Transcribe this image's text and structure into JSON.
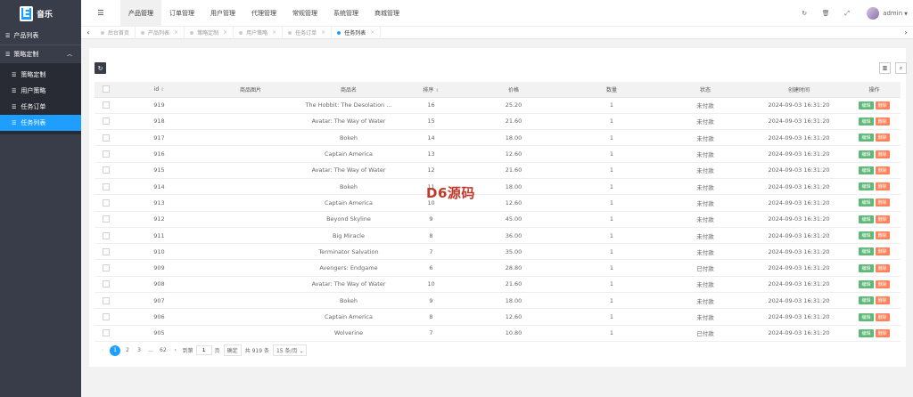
{
  "logo": {
    "letter": "E",
    "title": "音乐"
  },
  "sidebar": {
    "top_item": "产品列表",
    "parent_item": "策略定制",
    "sub_items": [
      {
        "label": "策略定制",
        "active": false
      },
      {
        "label": "用户策略",
        "active": false
      },
      {
        "label": "任务订单",
        "active": false
      },
      {
        "label": "任务列表",
        "active": true
      }
    ]
  },
  "header": {
    "nav": [
      "产品管理",
      "订单管理",
      "用户管理",
      "代理管理",
      "常规管理",
      "系统管理",
      "商城管理"
    ],
    "active_nav": 0,
    "username": "admin"
  },
  "tabs": [
    {
      "label": "后台首页",
      "closable": false,
      "active": false
    },
    {
      "label": "产品列表",
      "closable": true,
      "active": false
    },
    {
      "label": "策略定制",
      "closable": true,
      "active": false
    },
    {
      "label": "用户策略",
      "closable": true,
      "active": false
    },
    {
      "label": "任务订单",
      "closable": true,
      "active": false
    },
    {
      "label": "任务列表",
      "closable": true,
      "active": true
    }
  ],
  "table": {
    "columns": [
      "id",
      "商品图片",
      "商品名",
      "排序",
      "价格",
      "数量",
      "状态",
      "创建时间",
      "操作"
    ],
    "edit_label": "编辑",
    "delete_label": "删除",
    "rows": [
      {
        "id": "919",
        "name": "The Hobbit: The Desolation ...",
        "sort": "16",
        "price": "25.20",
        "qty": "1",
        "status": "未付款",
        "time": "2024-09-03 16:31:20"
      },
      {
        "id": "918",
        "name": "Avatar: The Way of Water",
        "sort": "15",
        "price": "21.60",
        "qty": "1",
        "status": "未付款",
        "time": "2024-09-03 16:31:20"
      },
      {
        "id": "917",
        "name": "Bokeh",
        "sort": "14",
        "price": "18.00",
        "qty": "1",
        "status": "未付款",
        "time": "2024-09-03 16:31:20"
      },
      {
        "id": "916",
        "name": "Captain America",
        "sort": "13",
        "price": "12.60",
        "qty": "1",
        "status": "未付款",
        "time": "2024-09-03 16:31:20"
      },
      {
        "id": "915",
        "name": "Avatar: The Way of Water",
        "sort": "12",
        "price": "21.60",
        "qty": "1",
        "status": "未付款",
        "time": "2024-09-03 16:31:20"
      },
      {
        "id": "914",
        "name": "Bokeh",
        "sort": "11",
        "price": "18.00",
        "qty": "1",
        "status": "未付款",
        "time": "2024-09-03 16:31:20"
      },
      {
        "id": "913",
        "name": "Captain America",
        "sort": "10",
        "price": "12.60",
        "qty": "1",
        "status": "未付款",
        "time": "2024-09-03 16:31:20"
      },
      {
        "id": "912",
        "name": "Beyond Skyline",
        "sort": "9",
        "price": "45.00",
        "qty": "1",
        "status": "未付款",
        "time": "2024-09-03 16:31:20"
      },
      {
        "id": "911",
        "name": "Big Miracle",
        "sort": "8",
        "price": "36.00",
        "qty": "1",
        "status": "未付款",
        "time": "2024-09-03 16:31:20"
      },
      {
        "id": "910",
        "name": "Terminator Salvation",
        "sort": "7",
        "price": "35.00",
        "qty": "1",
        "status": "未付款",
        "time": "2024-09-03 16:31:20"
      },
      {
        "id": "909",
        "name": "Avengers: Endgame",
        "sort": "6",
        "price": "28.80",
        "qty": "1",
        "status": "已付款",
        "time": "2024-09-03 16:31:20"
      },
      {
        "id": "908",
        "name": "Avatar: The Way of Water",
        "sort": "10",
        "price": "21.60",
        "qty": "1",
        "status": "未付款",
        "time": "2024-09-03 16:31:20"
      },
      {
        "id": "907",
        "name": "Bokeh",
        "sort": "9",
        "price": "18.00",
        "qty": "1",
        "status": "未付款",
        "time": "2024-09-03 16:31:20"
      },
      {
        "id": "906",
        "name": "Captain America",
        "sort": "8",
        "price": "12.60",
        "qty": "1",
        "status": "未付款",
        "time": "2024-09-03 16:31:20"
      },
      {
        "id": "905",
        "name": "Wolverine",
        "sort": "7",
        "price": "10.80",
        "qty": "1",
        "status": "已付款",
        "time": "2024-09-03 16:31:20"
      }
    ]
  },
  "pager": {
    "pages": [
      "1",
      "2",
      "3",
      "...",
      "62"
    ],
    "current": "1",
    "goto_label": "到第",
    "goto_value": "1",
    "page_suffix": "页",
    "ok_label": "确定",
    "total": "共 919 条",
    "per_page": "15 条/页"
  },
  "watermark": "D6源码",
  "colors": {
    "accent": "#1e9fff",
    "sidebar": "#393d49",
    "edit": "#5fb878",
    "delete": "#ff5722"
  }
}
